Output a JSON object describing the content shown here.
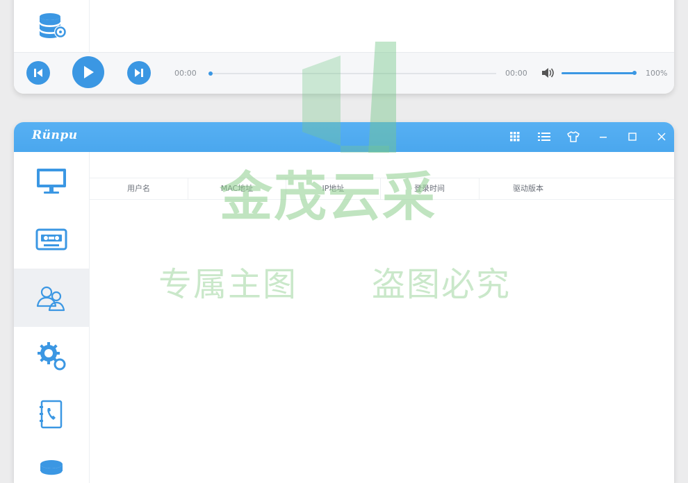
{
  "player": {
    "current_time": "00:00",
    "total_time": "00:00",
    "progress": 0,
    "volume_percent": 100,
    "volume_label": "100%"
  },
  "app": {
    "logo_text": "Rünpu"
  },
  "titlebar": {
    "icons": [
      "grid-icon",
      "list-icon",
      "shirt-icon",
      "minimize-icon",
      "maximize-icon",
      "close-icon"
    ]
  },
  "sidebar": {
    "items": [
      {
        "icon": "monitor-icon",
        "active": false
      },
      {
        "icon": "cassette-icon",
        "active": false
      },
      {
        "icon": "users-icon",
        "active": true
      },
      {
        "icon": "gear-icon",
        "active": false
      },
      {
        "icon": "phonebook-icon",
        "active": false
      },
      {
        "icon": "database-icon",
        "active": false
      }
    ]
  },
  "table": {
    "columns": [
      "用户名",
      "MAC地址",
      "IP地址",
      "登录时间",
      "驱动版本"
    ],
    "rows": []
  },
  "watermark": {
    "big": "金茂云采",
    "left": "专属主图",
    "right": "盗图必究"
  },
  "colors": {
    "accent": "#3b97e3",
    "titlebar": "#4aa7ee",
    "watermark": "#8ccd8c"
  }
}
